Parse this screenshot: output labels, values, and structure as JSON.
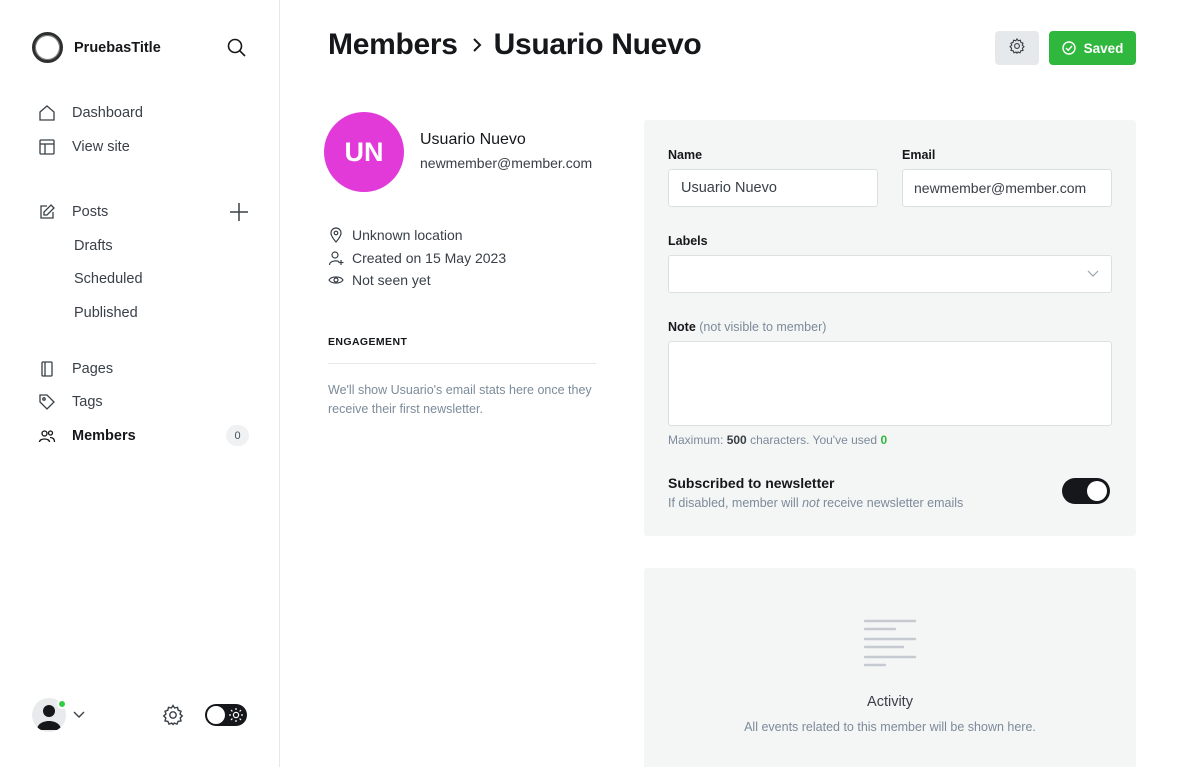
{
  "sidebar": {
    "site_title": "PruebasTitle",
    "nav": {
      "dashboard": "Dashboard",
      "view_site": "View site",
      "posts": "Posts",
      "drafts": "Drafts",
      "scheduled": "Scheduled",
      "published": "Published",
      "pages": "Pages",
      "tags": "Tags",
      "members": "Members",
      "members_count": "0"
    }
  },
  "header": {
    "breadcrumb_parent": "Members",
    "breadcrumb_current": "Usuario Nuevo",
    "saved_label": "Saved"
  },
  "member": {
    "initials": "UN",
    "name": "Usuario Nuevo",
    "email": "newmember@member.com",
    "location": "Unknown location",
    "created": "Created on 15 May 2023",
    "last_seen": "Not seen yet",
    "avatar_color": "#e23ad8"
  },
  "engagement": {
    "title": "ENGAGEMENT",
    "text": "We'll show Usuario's email stats here once they receive their first newsletter."
  },
  "form": {
    "name_label": "Name",
    "name_value": "Usuario Nuevo",
    "email_label": "Email",
    "email_value": "newmember@member.com",
    "labels_label": "Labels",
    "labels_value": "",
    "note_label": "Note",
    "note_hint": "(not visible to member)",
    "note_value": "",
    "counter_prefix": "Maximum:",
    "counter_max": "500",
    "counter_middle": "characters. You've used",
    "counter_used": "0",
    "subscribed_title": "Subscribed to newsletter",
    "subscribed_desc_before": "If disabled, member will",
    "subscribed_desc_em": "not",
    "subscribed_desc_after": "receive newsletter emails",
    "subscribed": true
  },
  "activity": {
    "title": "Activity",
    "desc": "All events related to this member will be shown here."
  },
  "colors": {
    "accent_green": "#30b83e",
    "online_dot": "#30cf43"
  }
}
